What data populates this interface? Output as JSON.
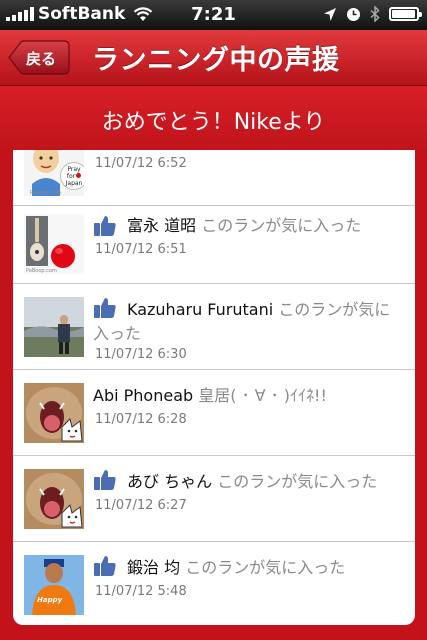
{
  "status_bar": {
    "carrier": "SoftBank",
    "time": "7:21",
    "battery_level": 0.95
  },
  "nav": {
    "back_label": "戻る",
    "title": "ランニング中の声援"
  },
  "banner": {
    "text": "おめでとう！Nikeより"
  },
  "colors": {
    "nav_red": "#c4121a",
    "facebook_like_blue": "#4a6db3"
  },
  "pray_badge": {
    "line1": "Pray",
    "line2": "for",
    "line3": "Japan"
  },
  "feed": [
    {
      "liked": false,
      "name": "",
      "action": "",
      "time": "11/07/12  6:52"
    },
    {
      "liked": true,
      "name": "富永 道昭",
      "action": "このランが気に入った",
      "time": "11/07/12  6:51"
    },
    {
      "liked": true,
      "name": "Kazuharu Furutani",
      "action": "このランが気に",
      "action2": "入った",
      "time": "11/07/12  6:30"
    },
    {
      "liked": false,
      "name": "Abi Phoneab",
      "action": "皇居( ･ ∀ ･ )ｲｲﾈ!!",
      "time": "11/07/12  6:28"
    },
    {
      "liked": true,
      "name": "あび ちゃん",
      "action": "このランが気に入った",
      "time": "11/07/12  6:27"
    },
    {
      "liked": true,
      "name": "鍛治 均",
      "action": "このランが気に入った",
      "time": "11/07/12  5:48"
    }
  ]
}
